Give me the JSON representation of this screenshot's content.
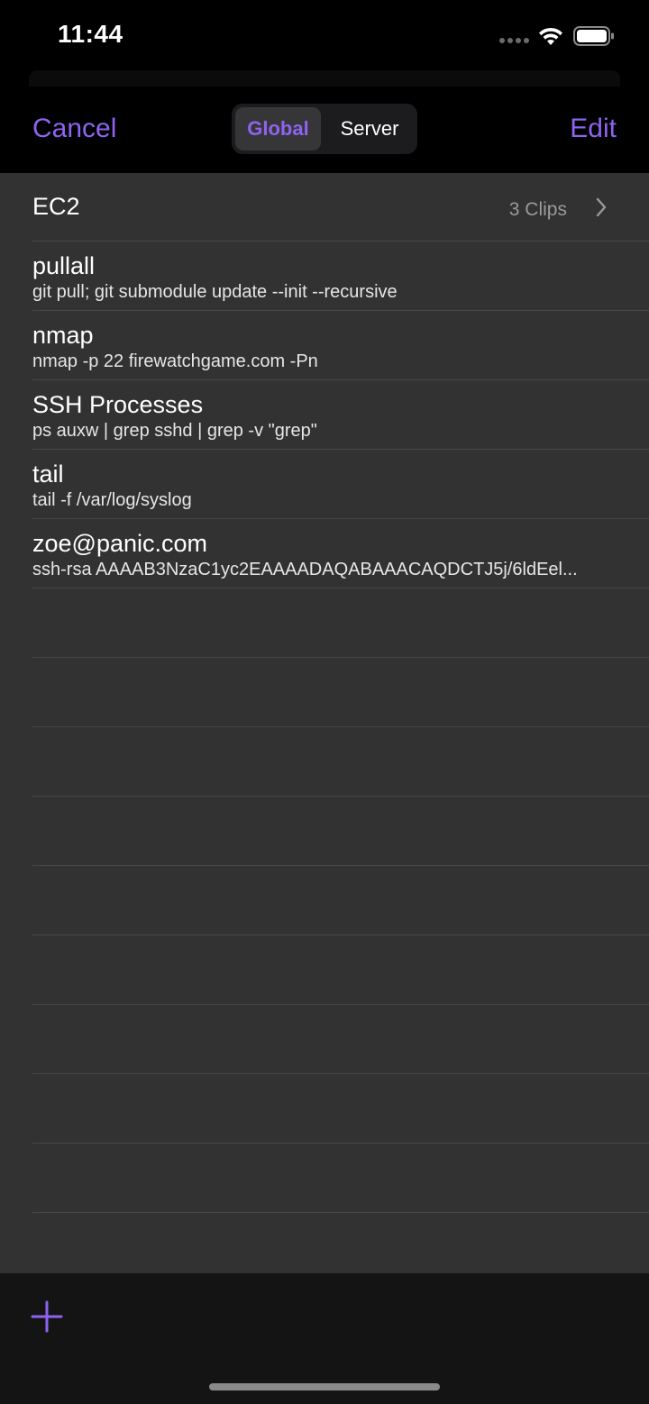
{
  "status_bar": {
    "time": "11:44"
  },
  "nav": {
    "cancel_label": "Cancel",
    "edit_label": "Edit",
    "segments": [
      "Global",
      "Server"
    ],
    "selected_segment": "Global"
  },
  "folder": {
    "title": "EC2",
    "count_label": "3 Clips"
  },
  "clips": [
    {
      "title": "pullall",
      "command": "git pull; git submodule update --init --recursive"
    },
    {
      "title": "nmap",
      "command": "nmap -p 22 firewatchgame.com -Pn"
    },
    {
      "title": "SSH Processes",
      "command": "ps auxw | grep sshd | grep -v \"grep\""
    },
    {
      "title": "tail",
      "command": "tail -f /var/log/syslog"
    },
    {
      "title": "zoe@panic.com",
      "command": "ssh-rsa AAAAB3NzaC1yc2EAAAADAQABAAACAQDCTJ5j/6ldEel..."
    }
  ],
  "colors": {
    "accent": "#8e63f0",
    "background": "#323232",
    "bar_background": "#000000",
    "toolbar_background": "#141414",
    "separator": "#474747"
  },
  "icons": {
    "add": "plus-icon",
    "chevron": "chevron-right-icon",
    "wifi": "wifi-icon",
    "battery": "battery-icon"
  }
}
